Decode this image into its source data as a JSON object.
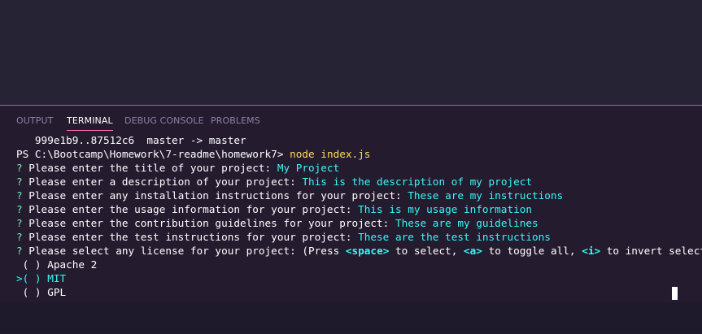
{
  "panel": {
    "tabs": [
      {
        "label": "OUTPUT"
      },
      {
        "label": "TERMINAL"
      },
      {
        "label": "DEBUG CONSOLE"
      },
      {
        "label": "PROBLEMS"
      }
    ],
    "active_tab": "TERMINAL"
  },
  "terminal": {
    "git_line": "   999e1b9..87512c6  master -> master",
    "prompt": "PS C:\\Bootcamp\\Homework\\7-readme\\homework7>",
    "command": "node index.js",
    "questions": [
      {
        "mark": "?",
        "text": "Please enter the title of your project:",
        "answer": "My Project"
      },
      {
        "mark": "?",
        "text": "Please enter a description of your project:",
        "answer": "This is the description of my project"
      },
      {
        "mark": "?",
        "text": "Please enter any installation instructions for your project:",
        "answer": "These are my instructions"
      },
      {
        "mark": "?",
        "text": "Please enter the usage information for your project:",
        "answer": "This is my usage information"
      },
      {
        "mark": "?",
        "text": "Please enter the contribution guidelines for your project:",
        "answer": "These are my guidelines"
      },
      {
        "mark": "?",
        "text": "Please enter the test instructions for your project:",
        "answer": "These are the test instructions"
      }
    ],
    "license_question": {
      "mark": "?",
      "text": "Please select any license for your project:",
      "hint_open": "(Press",
      "key_space": "<space>",
      "hint_select": "to select,",
      "key_a": "<a>",
      "hint_toggle": "to toggle all,",
      "key_i": "<i>",
      "hint_invert": "to invert selection)"
    },
    "options": [
      {
        "pointer": " ",
        "box": "( )",
        "label": "Apache 2",
        "selected": false
      },
      {
        "pointer": ">",
        "box": "( )",
        "label": "MIT",
        "selected": true
      },
      {
        "pointer": " ",
        "box": "( )",
        "label": "GPL",
        "selected": false
      }
    ]
  },
  "colors": {
    "background": "#262335",
    "panel": "#241b2f",
    "prompt_mark": "#72f1b8",
    "answer": "#36f9f6",
    "command": "#fede5d",
    "tab_underline": "#ff6bb3"
  }
}
